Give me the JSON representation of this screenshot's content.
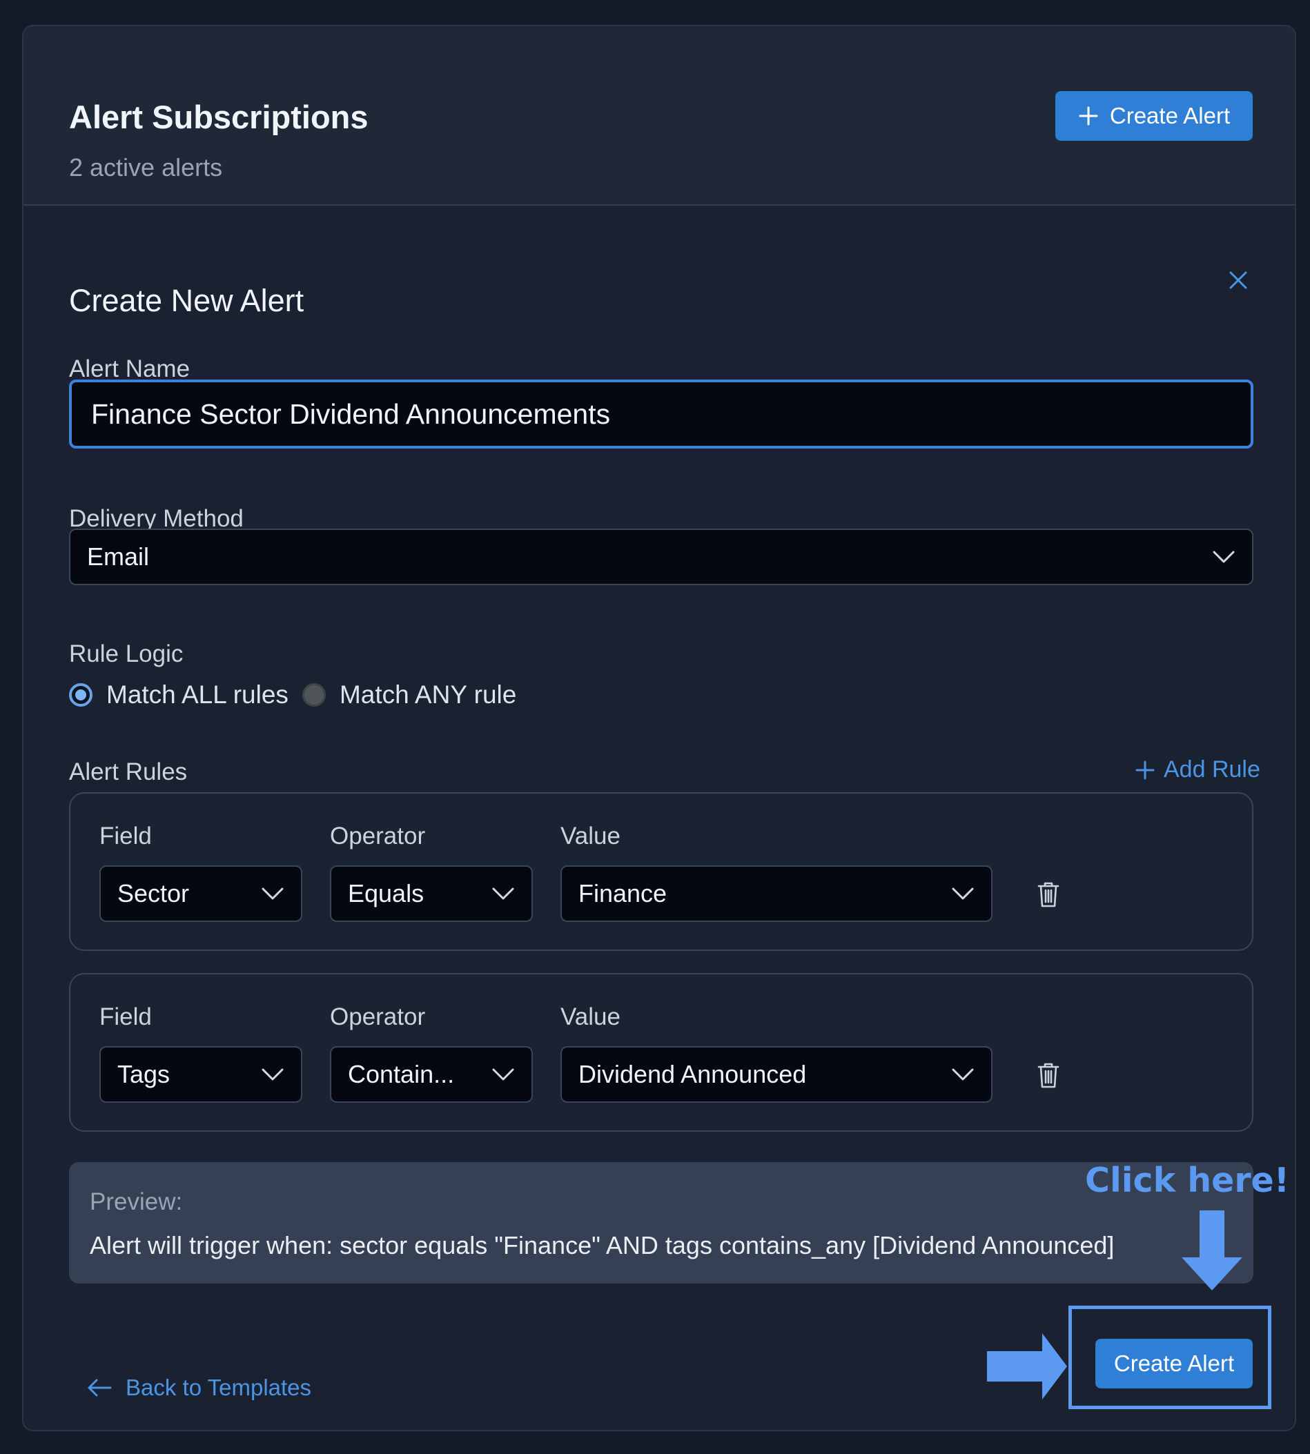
{
  "header": {
    "title": "Alert Subscriptions",
    "subtitle": "2 active alerts",
    "create_button": "Create Alert"
  },
  "form": {
    "title": "Create New Alert",
    "close_icon": "close-icon",
    "alert_name": {
      "label": "Alert Name",
      "value": "Finance Sector Dividend Announcements"
    },
    "delivery_method": {
      "label": "Delivery Method",
      "value": "Email"
    },
    "rule_logic": {
      "label": "Rule Logic",
      "options": [
        {
          "label": "Match ALL rules",
          "selected": true
        },
        {
          "label": "Match ANY rule",
          "selected": false
        }
      ]
    },
    "alert_rules": {
      "label": "Alert Rules",
      "add_rule": "Add Rule",
      "rules": [
        {
          "field_label": "Field",
          "field": "Sector",
          "operator_label": "Operator",
          "operator": "Equals",
          "value_label": "Value",
          "value": "Finance"
        },
        {
          "field_label": "Field",
          "field": "Tags",
          "operator_label": "Operator",
          "operator": "Contain...",
          "value_label": "Value",
          "value": "Dividend Announced"
        }
      ]
    },
    "preview": {
      "label": "Preview:",
      "text": "Alert will trigger when: sector equals \"Finance\" AND tags contains_any [Dividend Announced]"
    },
    "back_link": "Back to Templates",
    "submit_button": "Create Alert"
  },
  "annotation": {
    "callout": "Click here!",
    "color": "#5b9af0"
  },
  "colors": {
    "accent": "#2f7fd6",
    "link": "#4a95e6",
    "background": "#141a28"
  }
}
